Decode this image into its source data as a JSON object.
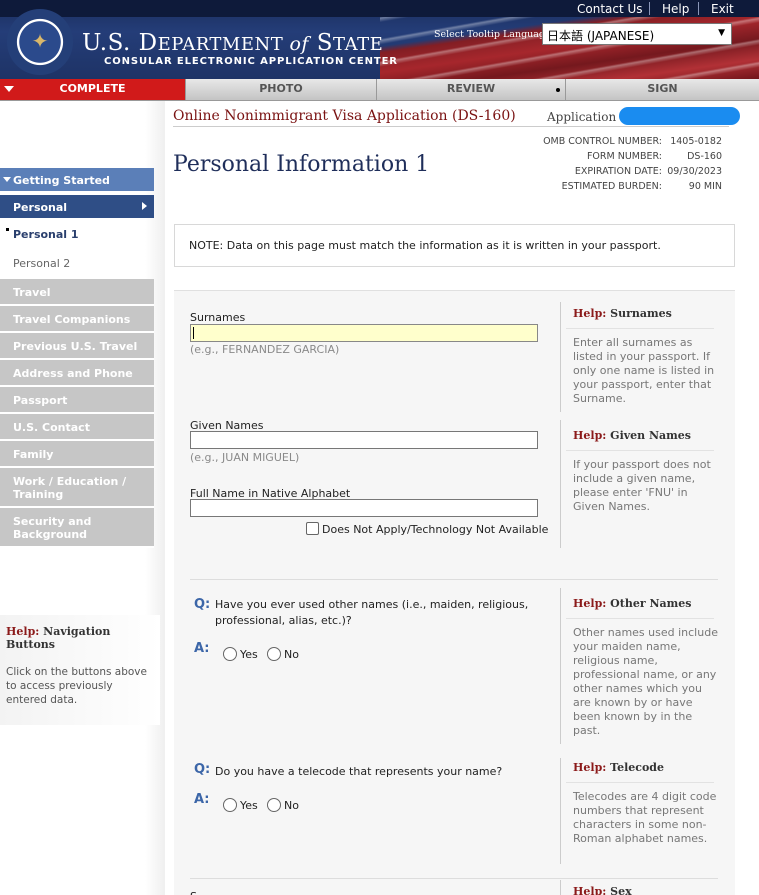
{
  "header": {
    "top_links": [
      "Contact Us",
      "Help",
      "Exit"
    ],
    "dept_prefix": "U.S. D",
    "dept_main": "EPARTMENT ",
    "dept_of": "of",
    "dept_state": " S",
    "dept_state_rest": "TATE",
    "subtitle": "CONSULAR ELECTRONIC APPLICATION CENTER",
    "tooltip_label": "Select Tooltip Language",
    "tooltip_value": "日本語 (JAPANESE)"
  },
  "tabs": [
    "COMPLETE",
    "PHOTO",
    "REVIEW",
    "SIGN"
  ],
  "sidebar": {
    "items": [
      "Getting Started",
      "Personal",
      "Personal 1",
      "Personal 2",
      "Travel",
      "Travel Companions",
      "Previous U.S. Travel",
      "Address and Phone",
      "Passport",
      "U.S. Contact",
      "Family",
      "Work / Education / Training",
      "Security and Background"
    ],
    "help_prefix": "Help:",
    "help_title": "Navigation Buttons",
    "help_text": "Click on the buttons above to access previously entered data."
  },
  "form": {
    "title": "Online Nonimmigrant Visa Application (DS-160)",
    "app_id_label": "Application ID",
    "omb": [
      {
        "k": "OMB CONTROL NUMBER:",
        "v": "1405-0182"
      },
      {
        "k": "FORM NUMBER:",
        "v": "DS-160"
      },
      {
        "k": "EXPIRATION DATE:",
        "v": "09/30/2023"
      },
      {
        "k": "ESTIMATED BURDEN:",
        "v": "90 MIN"
      }
    ],
    "page_title": "Personal Information 1",
    "note": "NOTE: Data on this page must match the information as it is written in your passport.",
    "surnames_label": "Surnames",
    "surnames_hint": "(e.g., FERNANDEZ GARCIA)",
    "given_label": "Given Names",
    "given_hint": "(e.g., JUAN MIGUEL)",
    "native_label": "Full Name in Native Alphabet",
    "dna_label": "Does Not Apply/Technology Not Available",
    "q_marker": "Q:",
    "a_marker": "A:",
    "q1": "Have you ever used other names (i.e., maiden, religious, professional, alias, etc.)?",
    "q2": "Do you have a telecode that represents your name?",
    "yes": "Yes",
    "no": "No",
    "last_label": "S"
  },
  "help": {
    "prefix": "Help:",
    "surnames_title": "Surnames",
    "surnames_text": "Enter all surnames as listed in your passport. If only one name is listed in your passport, enter that Surname.",
    "given_title": "Given Names",
    "given_text": "If your passport does not include a given name, please enter 'FNU' in Given Names.",
    "other_title": "Other Names",
    "other_text": "Other names used include your maiden name, religious name, professional name, or any other names which you are known by or have been known by in the past.",
    "telecode_title": "Telecode",
    "telecode_text": "Telecodes are 4 digit code numbers that represent characters in some non-Roman alphabet names.",
    "sex_title": "Sex"
  },
  "colors": {
    "accent_red": "#d11a1a",
    "nav_blue": "#2f4e86",
    "help_red": "#8b1a1a",
    "focus_yellow": "#ffffcc",
    "redaction_blue": "#1a8cf0"
  }
}
